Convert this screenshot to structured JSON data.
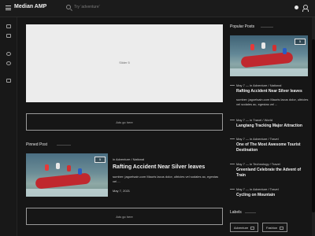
{
  "header": {
    "site_title": "Median AMP",
    "search_placeholder": "Try 'adventure'"
  },
  "rail": {
    "icons": [
      "folder-icon",
      "folder-icon",
      "users-icon",
      "clock-icon",
      "upload-icon"
    ]
  },
  "slider": {
    "label": "Slider 5"
  },
  "ads": {
    "top_label": "Ads go here",
    "bottom_label": "Ads go here"
  },
  "pinned": {
    "section_title": "Pinned Post",
    "comments": "5",
    "meta": "in Adventure / National",
    "title": "Rafting Accident Near Silver leaves",
    "excerpt": "sumber: jagoelsain.com Mauris lacus dolor, ultricies vel sodales ac, egestas vel ...",
    "date": "May 7, 2021"
  },
  "popular": {
    "section_title": "Popular Posts",
    "featured_comments": "5",
    "posts": [
      {
        "meta": "May 7 — in Adventure / National",
        "title": "Rafting Accident Near Silver leaves",
        "excerpt": "sumber: jagoelsain.com Mauris lacus dolor, ultricies vel sodales ac, egestas vel ..."
      },
      {
        "meta": "May 7 — in Travel / World",
        "title": "Langtang Tracking Major Attraction"
      },
      {
        "meta": "May 7 — in Adventure / Travel",
        "title": "One of The Most Awesome Tourist Destination"
      },
      {
        "meta": "May 7 — in Technology / Travel",
        "title": "Greenland Celebrate the Advent of Train"
      },
      {
        "meta": "May 7 — in Adventure / Travel",
        "title": "Cycling on Mountain"
      }
    ]
  },
  "labels": {
    "section_title": "Labels",
    "items": [
      {
        "name": "Adventure",
        "count": "5"
      },
      {
        "name": "Fashion",
        "count": "5"
      }
    ]
  }
}
